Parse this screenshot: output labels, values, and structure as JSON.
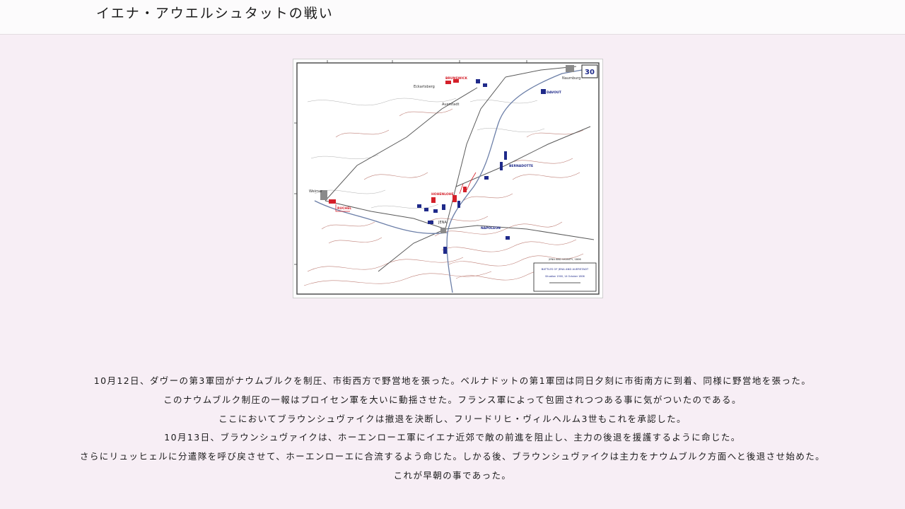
{
  "header": {
    "title": "イエナ・アウエルシュタットの戦い"
  },
  "map": {
    "plate_number": "30",
    "labels": {
      "weimar": "Weimar",
      "jena": "JENA",
      "eckartsberg": "Eckartsberg",
      "auerstadt": "Auerstadt",
      "naumburg": "Naumburg",
      "brunswick": "BRUNSWICK",
      "hohenlohe": "HOHENLOHE",
      "ruchel": "RUCHEL",
      "napoleon": "NAPOLEON",
      "bernadotte": "BERNADOTTE",
      "davout": "DAVOUT"
    },
    "legend": {
      "line1": "JENA AND VICINITY, 1806",
      "line2": "BATTLES OF JENA AND AUERSTADT",
      "line3": "Situation 1900, 14 October 1806"
    },
    "colors": {
      "prussian": "#d4202a",
      "french": "#1f2a8a",
      "terrain": "#b46a60",
      "road": "#5a5a5a",
      "river": "#6c7fa8"
    }
  },
  "paragraphs": [
    "10月12日、ダヴーの第3軍団がナウムブルクを制圧、市街西方で野営地を張った。ベルナドットの第1軍団は同日夕刻に市街南方に到着、同様に野営地を張った。",
    "このナウムブルク制圧の一報はプロイセン軍を大いに動揺させた。フランス軍によって包囲されつつある事に気がついたのである。",
    "ここにおいてブラウンシュヴァイクは撤退を決断し、フリードリヒ・ヴィルヘルム3世もこれを承認した。",
    "10月13日、ブラウンシュヴァイクは、ホーエンローエ軍にイエナ近郊で敵の前進を阻止し、主力の後退を援護するように命じた。",
    "さらにリュッヒェルに分遣隊を呼び戻させて、ホーエンローエに合流するよう命じた。しかる後、ブラウンシュヴァイクは主力をナウムブルク方面へと後退させ始めた。",
    "これが早朝の事であった。"
  ]
}
